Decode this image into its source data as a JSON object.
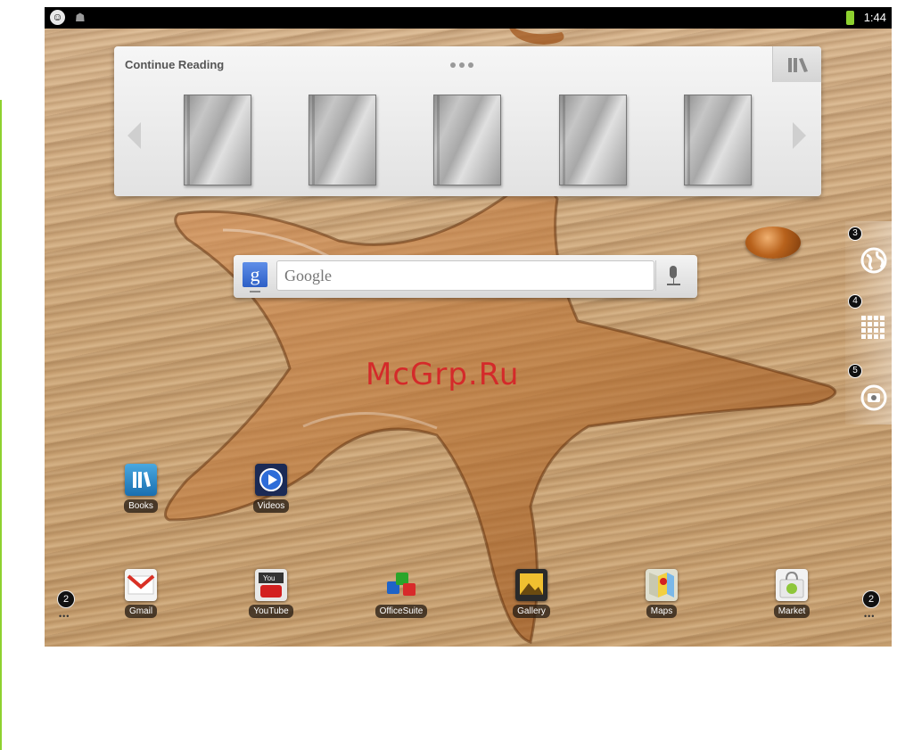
{
  "status_bar": {
    "time": "1:44",
    "left_icons": [
      "notification-icon",
      "usb-debug-icon"
    ],
    "battery_color": "#8ed12f"
  },
  "continue_reading": {
    "title": "Continue Reading",
    "books": [
      "book-1",
      "book-2",
      "book-3",
      "book-4",
      "book-5"
    ]
  },
  "search": {
    "g_label": "g",
    "placeholder": "Google"
  },
  "side_panel": {
    "items": [
      {
        "number": "3",
        "icon": "browser-globe-icon"
      },
      {
        "number": "4",
        "icon": "apps-grid-icon"
      },
      {
        "number": "5",
        "icon": "camera-icon"
      }
    ]
  },
  "home_apps": [
    {
      "label": "Books",
      "icon": "books-icon"
    },
    {
      "label": "Videos",
      "icon": "videos-icon"
    }
  ],
  "dock_apps": [
    {
      "label": "Gmail",
      "icon": "gmail-icon"
    },
    {
      "label": "YouTube",
      "icon": "youtube-icon"
    },
    {
      "label": "OfficeSuite",
      "icon": "officesuite-icon"
    },
    {
      "label": "Gallery",
      "icon": "gallery-icon"
    },
    {
      "label": "Maps",
      "icon": "maps-icon"
    },
    {
      "label": "Market",
      "icon": "market-icon"
    }
  ],
  "page_buttons": {
    "left": "2",
    "right": "2"
  },
  "watermark": "McGrp.Ru"
}
